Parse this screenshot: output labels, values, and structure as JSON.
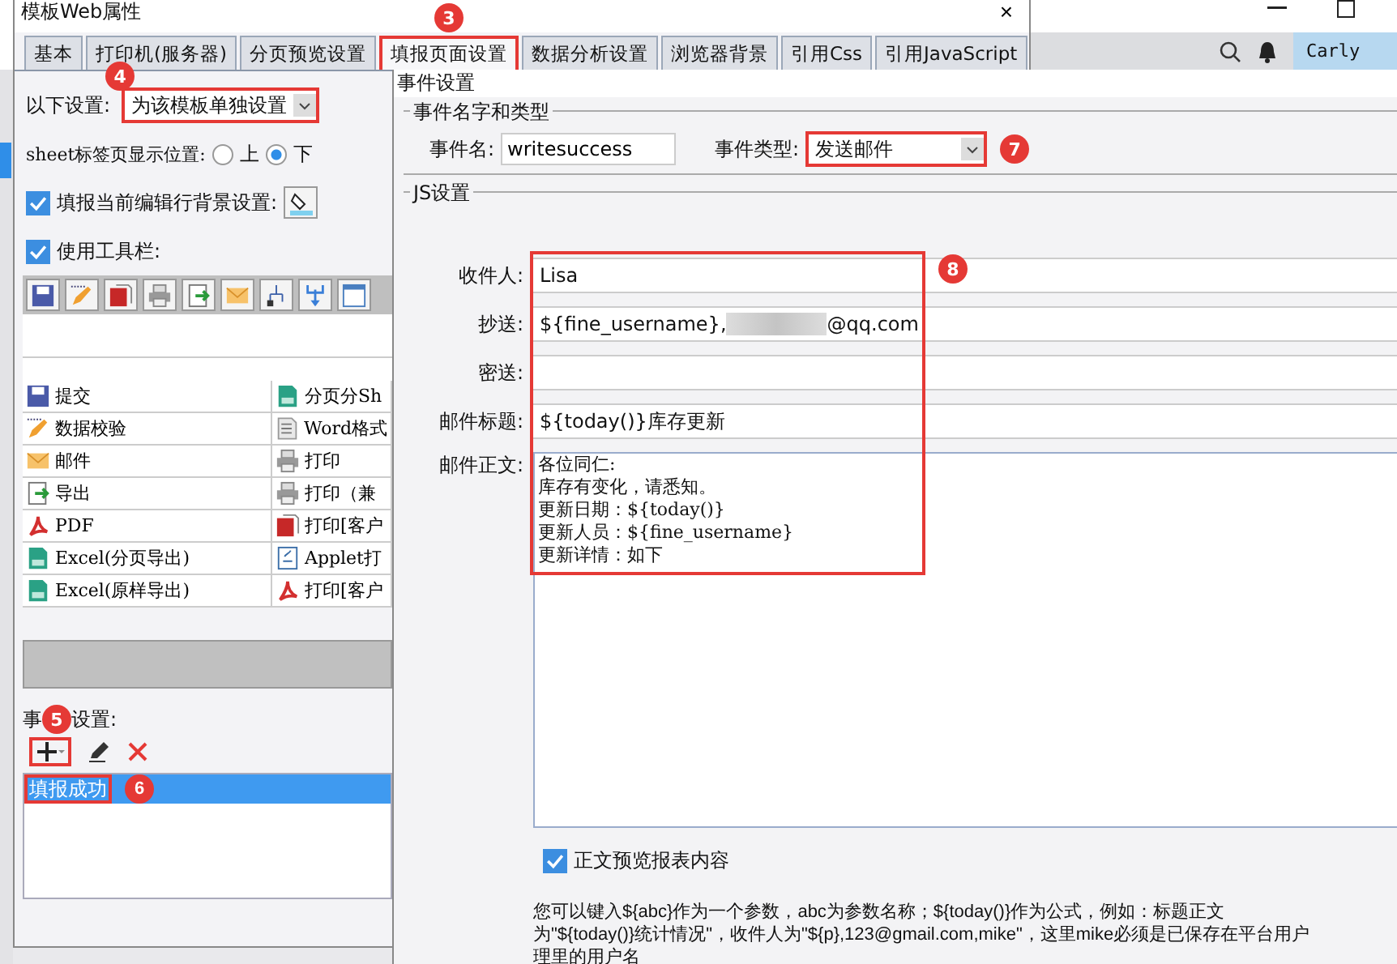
{
  "app": {
    "user": "Carly"
  },
  "dialog": {
    "title": "模板Web属性",
    "close": "×"
  },
  "tabs": [
    {
      "label": "基本",
      "selected": false
    },
    {
      "label": "打印机(服务器)",
      "selected": false
    },
    {
      "label": "分页预览设置",
      "selected": false
    },
    {
      "label": "填报页面设置",
      "selected": true,
      "badge": "3"
    },
    {
      "label": "数据分析设置",
      "selected": false
    },
    {
      "label": "浏览器背景",
      "selected": false
    },
    {
      "label": "引用Css",
      "selected": false
    },
    {
      "label": "引用JavaScript",
      "selected": false
    }
  ],
  "left": {
    "setting": {
      "label": "以下设置:",
      "value": "为该模板单独设置",
      "badge": "4"
    },
    "sheet": {
      "label": "sheet标签页显示位置:",
      "options": [
        {
          "label": "上",
          "selected": false
        },
        {
          "label": "下",
          "selected": true
        }
      ]
    },
    "checks": [
      {
        "label": "填报当前编辑行背景设置:",
        "checked": true,
        "kind": "paint"
      },
      {
        "label": "使用工具栏:",
        "checked": true,
        "kind": "plain"
      }
    ],
    "buttons": [
      [
        {
          "label": "提交",
          "kind": "save"
        },
        {
          "label": "分页分Sh",
          "kind": "excel"
        }
      ],
      [
        {
          "label": "数据校验",
          "kind": "pencil"
        },
        {
          "label": "Word格式",
          "kind": "word"
        }
      ],
      [
        {
          "label": "邮件",
          "kind": "mail"
        },
        {
          "label": "打印",
          "kind": "print"
        }
      ],
      [
        {
          "label": "导出",
          "kind": "export"
        },
        {
          "label": "打印（兼",
          "kind": "print"
        }
      ],
      [
        {
          "label": "PDF",
          "kind": "pdf"
        },
        {
          "label": "打印[客户",
          "kind": "flash"
        }
      ],
      [
        {
          "label": "Excel(分页导出)",
          "kind": "excel"
        },
        {
          "label": "Applet打",
          "kind": "applet"
        }
      ],
      [
        {
          "label": "Excel(原样导出)",
          "kind": "excel"
        },
        {
          "label": "打印[客户",
          "kind": "pdf"
        }
      ]
    ],
    "events_label": [
      "事",
      "设置:"
    ],
    "events_badge": "5",
    "events": [
      {
        "label": "填报成功",
        "selected": true,
        "badge": "6"
      }
    ]
  },
  "event_panel": {
    "title": "事件设置",
    "group_name": "事件名字和类型",
    "name_label": "事件名:",
    "name_value": "writesuccess",
    "type_label": "事件类型:",
    "type_value": "发送邮件",
    "type_badge": "7",
    "group_js": "JS设置",
    "fields_badge": "8",
    "fields": [
      {
        "label": "收件人:",
        "kind": "plain",
        "value": "Lisa"
      },
      {
        "label": "抄送:",
        "kind": "redacted",
        "value": "${fine_username},",
        "value_after": "@qq.com"
      },
      {
        "label": "密送:",
        "kind": "empty"
      },
      {
        "label": "邮件标题:",
        "kind": "plain",
        "value": "${today()}库存更新"
      }
    ],
    "body_label": "邮件正文:",
    "body_lines": [
      "各位同仁:",
      "库存有变化，请悉知。",
      "更新日期：${today()}",
      "更新人员：${fine_username}",
      "更新详情：如下"
    ],
    "preview": {
      "label": "正文预览报表内容",
      "checked": true
    },
    "help_lines": [
      "您可以键入${abc}作为一个参数，abc为参数名称；${today()}作为公式，例如：标题正文",
      "为\"${today()}统计情况\"，收件人为\"${p},123@gmail.com,mike\"，这里mike必须是已保存在平台用户",
      "理里的用户名"
    ]
  }
}
